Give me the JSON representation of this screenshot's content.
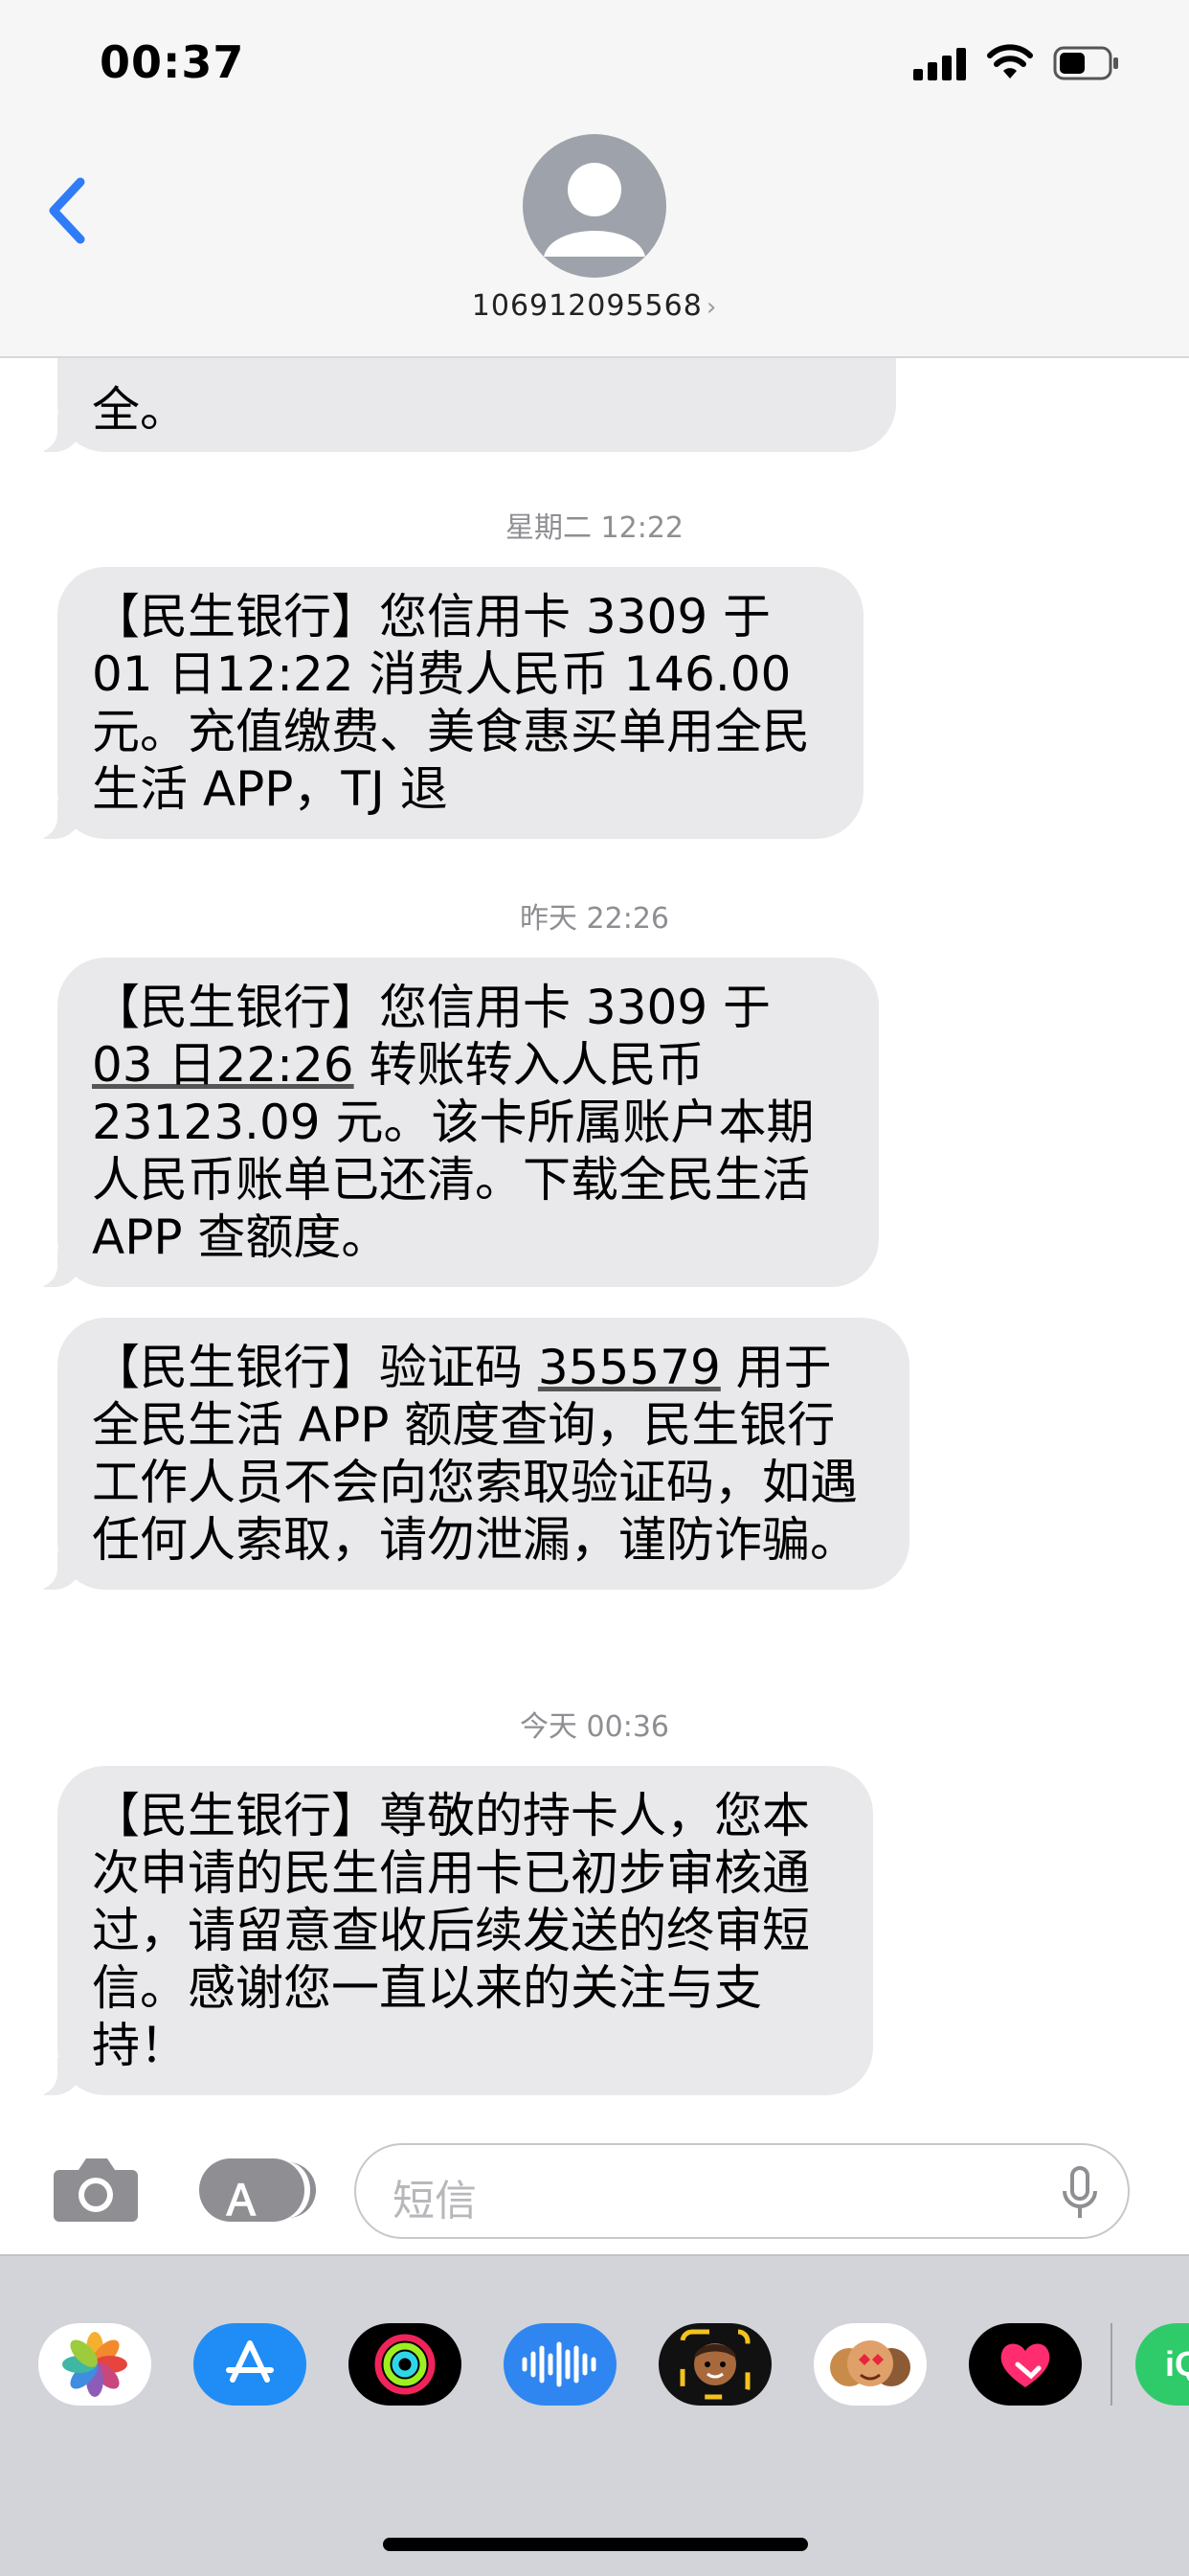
{
  "status_bar": {
    "time": "00:37"
  },
  "header": {
    "contact": "106912095568"
  },
  "messages": [
    {
      "text_1": "全。"
    },
    {
      "timestamp": "星期二 12:22",
      "text": "【民生银行】您信用卡 3309 于 01 日12:22 消费人民币 146.00元。充值缴费、美食惠买单用全民生活 APP，TJ 退"
    },
    {
      "timestamp": "昨天 22:26",
      "pre": "【民生银行】您信用卡 3309 于 ",
      "link": "03 日22:26",
      "post": " 转账转入人民币 23123.09 元。该卡所属账户本期人民币账单已还清。下载全民生活 APP 查额度。"
    },
    {
      "pre": "【民生银行】验证码 ",
      "link": "355579",
      "post": " 用于全民生活 APP 额度查询，民生银行工作人员不会向您索取验证码，如遇任何人索取，请勿泄漏，谨防诈骗。"
    },
    {
      "timestamp": "今天 00:36",
      "text": "【民生银行】尊敬的持卡人，您本次申请的民生信用卡已初步审核通过，请留意查收后续发送的终审短信。感谢您一直以来的关注与支持！"
    }
  ],
  "compose": {
    "placeholder": "短信"
  },
  "colors": {
    "bubble": "#e9e9eb",
    "accent": "#2f7cf6",
    "timestamp": "#8e8e93"
  },
  "icons": [
    "back-chevron-icon",
    "contact-avatar-icon",
    "camera-icon",
    "app-store-icon",
    "microphone-icon",
    "photos-app-icon",
    "app-store-app-icon",
    "activity-app-icon",
    "audio-message-app-icon",
    "memoji-app-icon",
    "memoji-stickers-app-icon",
    "digital-touch-app-icon",
    "iqiyi-app-icon"
  ]
}
